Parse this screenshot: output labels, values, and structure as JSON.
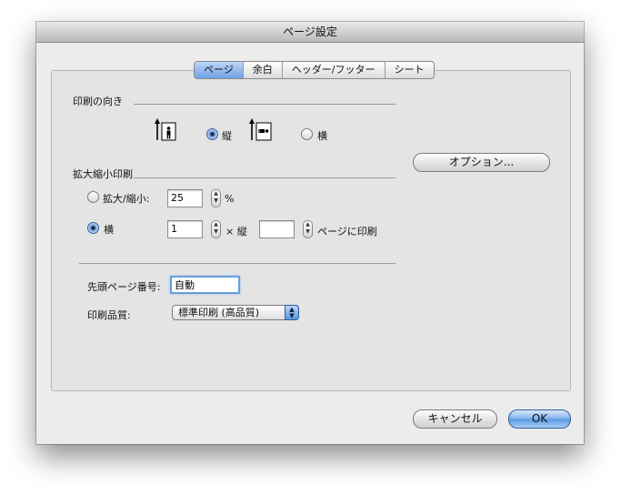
{
  "window": {
    "title": "ページ設定"
  },
  "tabs": [
    {
      "label": "ページ",
      "selected": true
    },
    {
      "label": "余白",
      "selected": false
    },
    {
      "label": "ヘッダー/フッター",
      "selected": false
    },
    {
      "label": "シート",
      "selected": false
    }
  ],
  "orientation": {
    "section_label": "印刷の向き",
    "portrait_label": "縦",
    "portrait_selected": true,
    "landscape_label": "横",
    "landscape_selected": false
  },
  "scaling": {
    "section_label": "拡大縮小印刷",
    "adjust_label": "拡大/縮小:",
    "adjust_value": "25",
    "percent_unit": "%",
    "fit_label": "横",
    "fit_wide_value": "1",
    "times_label": "× 縦",
    "fit_tall_value": "",
    "pages_label": "ページに印刷"
  },
  "options_button": {
    "label": "オプション..."
  },
  "first_page": {
    "label": "先頭ページ番号:",
    "value": "自動"
  },
  "print_quality": {
    "label": "印刷品質:",
    "selected": "標準印刷 (高品質)"
  },
  "buttons": {
    "cancel": "キャンセル",
    "ok": "OK"
  },
  "colors": {
    "accent": "#5a97e1",
    "tab_selected": "#6ea1e4"
  },
  "icons": [
    "arrow-up-icon",
    "person-portrait-icon",
    "person-landscape-icon",
    "stepper-arrows-icon",
    "popup-arrows-icon"
  ]
}
